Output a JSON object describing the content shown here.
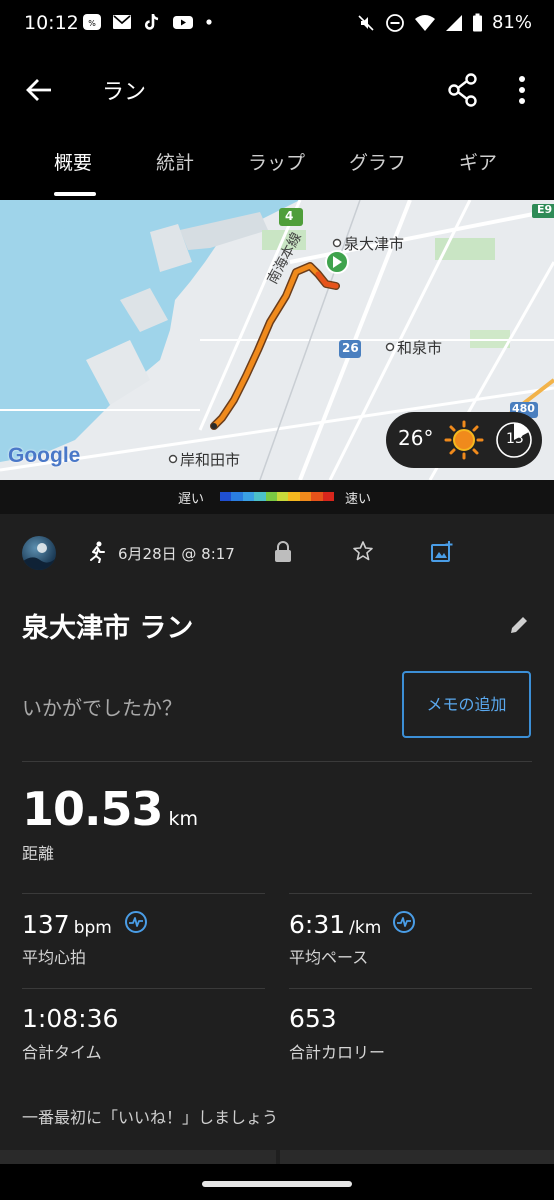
{
  "status_bar": {
    "time": "10:12",
    "battery": "81%",
    "icons": [
      "voicemail-icon",
      "mail-icon",
      "tiktok-icon",
      "youtube-icon",
      "dot-icon",
      "mute-icon",
      "dnd-icon",
      "wifi-icon",
      "signal-icon",
      "battery-icon"
    ]
  },
  "app_bar": {
    "title": "ラン",
    "icons": [
      "back-arrow-icon",
      "share-icon",
      "more-vert-icon"
    ]
  },
  "tabs": [
    {
      "label": "概要",
      "active": true
    },
    {
      "label": "統計",
      "active": false
    },
    {
      "label": "ラップ",
      "active": false
    },
    {
      "label": "グラフ",
      "active": false
    },
    {
      "label": "ギア",
      "active": false
    }
  ],
  "map": {
    "labels": {
      "city1": "泉大津市",
      "city2": "和泉市",
      "city3": "岸和田市",
      "rail": "南海本線",
      "road1": "4",
      "road2": "26",
      "road3": "480",
      "road4": "E9",
      "logo": "Google"
    },
    "weather": {
      "temp": "26°",
      "wind": "13",
      "condition_icon": "sun-icon"
    }
  },
  "pace_legend": {
    "slow": "遅い",
    "fast": "速い",
    "colors": [
      "#1f4fd1",
      "#2a7de0",
      "#3aa0e4",
      "#4cc0c8",
      "#7ac943",
      "#c8d93a",
      "#f5b81f",
      "#f08a1c",
      "#e6531a",
      "#d7261c"
    ]
  },
  "activity": {
    "date": "6月28日 @ 8:17",
    "title": "泉大津市 ラン",
    "prompt": "いかがでしたか？",
    "memo_button": "メモの追加",
    "distance": {
      "value": "10.53",
      "unit": "km",
      "label": "距離"
    },
    "avg_hr": {
      "value": "137",
      "unit": "bpm",
      "label": "平均心拍"
    },
    "avg_pace": {
      "value": "6:31",
      "unit": "/km",
      "label": "平均ペース"
    },
    "total_time": {
      "value": "1:08:36",
      "label": "合計タイム"
    },
    "calories": {
      "value": "653",
      "label": "合計カロリー"
    },
    "like_prompt": "一番最初に「いいね！」しましょう"
  }
}
